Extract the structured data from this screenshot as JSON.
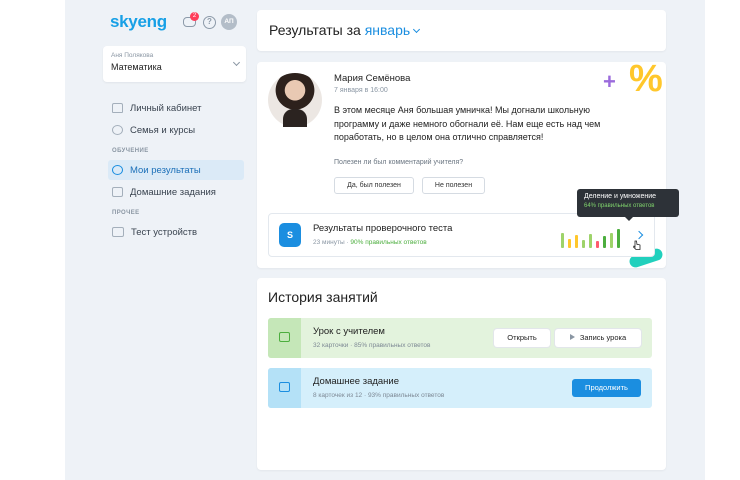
{
  "logo": "skyeng",
  "header": {
    "chat_badge": "2",
    "help": "?",
    "avatar_initials": "АП"
  },
  "student": {
    "name": "Аня Полякова",
    "subject": "Математика"
  },
  "sidebar": {
    "items": [
      {
        "label": "Личный кабинет",
        "icon": "home-icon"
      },
      {
        "label": "Семья и курсы",
        "icon": "family-icon"
      }
    ],
    "section_learning": "ОБУЧЕНИЕ",
    "learning_items": [
      {
        "label": "Мои результаты",
        "icon": "results-icon",
        "active": true
      },
      {
        "label": "Домашние задания",
        "icon": "homework-icon"
      }
    ],
    "section_other": "ПРОЧЕЕ",
    "other_items": [
      {
        "label": "Тест устройств",
        "icon": "camera-icon"
      }
    ]
  },
  "results": {
    "title": "Результаты за",
    "month": "январь"
  },
  "feedback": {
    "teacher": "Мария Семёнова",
    "date": "7 января в 16:00",
    "comment": "В этом месяце Аня большая умничка! Мы догнали школьную программу и даже немного обогнали её. Нам еще есть над чем поработать, но в целом она отлично справляется!",
    "question": "Полезен ли был комментарий учителя?",
    "yes": "Да, был полезен",
    "no": "Не полезен"
  },
  "test": {
    "icon_letter": "S",
    "title": "Результаты проверочного теста",
    "duration": "23 минуты",
    "separator": " · ",
    "score": "90% правильных ответов",
    "bars": [
      {
        "value": 0.75,
        "color": "#9ed36a"
      },
      {
        "value": 0.45,
        "color": "#ffc72c"
      },
      {
        "value": 0.65,
        "color": "#ffc72c"
      },
      {
        "value": 0.4,
        "color": "#9ed36a"
      },
      {
        "value": 0.7,
        "color": "#9ed36a"
      },
      {
        "value": 0.35,
        "color": "#ff5a6e"
      },
      {
        "value": 0.6,
        "color": "#4cae3e"
      },
      {
        "value": 0.75,
        "color": "#9ed36a"
      },
      {
        "value": 0.95,
        "color": "#4cae3e"
      }
    ]
  },
  "tooltip": {
    "title": "Деление и умножение",
    "subtitle": "64% правильных ответов"
  },
  "history": {
    "title": "История занятий",
    "lessons": [
      {
        "title": "Урок с учителем",
        "subtitle": "32 карточки · 85% правильных ответов",
        "open": "Открыть",
        "record": "Запись урока"
      },
      {
        "title": "Домашнее задание",
        "subtitle": "8 карточек из 12 · 93% правильных ответов",
        "continue": "Продолжить"
      }
    ]
  }
}
